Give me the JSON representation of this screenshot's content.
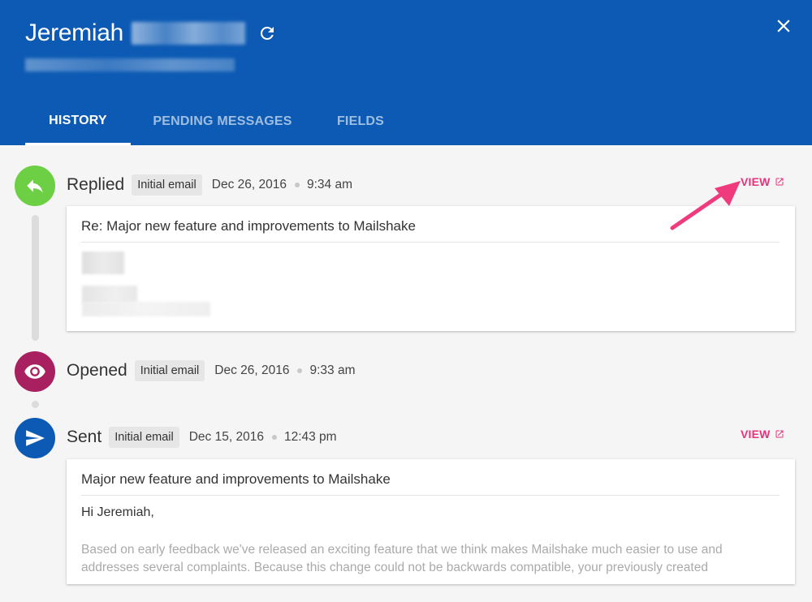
{
  "header": {
    "name": "Jeremiah",
    "tabs": [
      "HISTORY",
      "PENDING MESSAGES",
      "FIELDS"
    ],
    "active_tab": "HISTORY",
    "bg_color": "#0c5ab4"
  },
  "events": [
    {
      "type": "Replied",
      "badge": "Initial email",
      "date": "Dec 26, 2016",
      "time": "9:34 am",
      "view_label": "VIEW",
      "icon": "reply-icon",
      "icon_color": "#6dcf43",
      "card": {
        "subject": "Re: Major new feature and improvements to Mailshake"
      }
    },
    {
      "type": "Opened",
      "badge": "Initial email",
      "date": "Dec 26, 2016",
      "time": "9:33 am",
      "icon": "eye-icon",
      "icon_color": "#a8205f"
    },
    {
      "type": "Sent",
      "badge": "Initial email",
      "date": "Dec 15, 2016",
      "time": "12:43 pm",
      "view_label": "VIEW",
      "icon": "send-icon",
      "icon_color": "#0c5ab4",
      "card": {
        "subject": "Major new feature and improvements to Mailshake",
        "greeting": "Hi Jeremiah,",
        "body": "Based on early feedback we've released an exciting feature that we think makes Mailshake much easier to use and addresses several complaints. Because this change could not be backwards compatible, your previously created"
      }
    }
  ],
  "colors": {
    "accent": "#e8327c"
  }
}
